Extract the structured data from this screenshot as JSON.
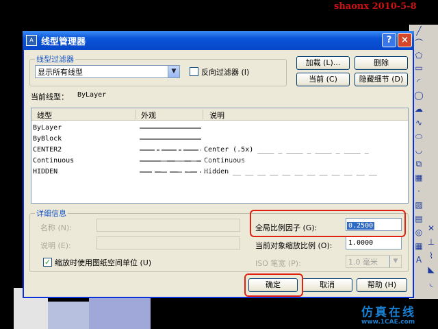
{
  "watermark": {
    "top_right": "shaonx 2010-5-8",
    "center": "1CAE.COM",
    "bottom_cn": "仿真在线",
    "bottom_url": "www.1CAE.com"
  },
  "dialog": {
    "title": "线型管理器",
    "help_label": "?",
    "close_label": "×",
    "filter_group": "线型过滤器",
    "filter_value": "显示所有线型",
    "invert_label": "反向过滤器 (I)",
    "load_button": "加载 (L)...",
    "delete_button": "删除",
    "current_button": "当前 (C)",
    "hide_details_button": "隐藏细节 (D)",
    "current_linetype_label": "当前线型：",
    "current_linetype_value": "ByLayer",
    "columns": [
      "线型",
      "外观",
      "说明"
    ],
    "rows": [
      {
        "name": "ByLayer",
        "description": ""
      },
      {
        "name": "ByBlock",
        "description": ""
      },
      {
        "name": "CENTER2",
        "description": "Center (.5x) ____ _ ____ _ ____ _ ____ _"
      },
      {
        "name": "Continuous",
        "description": "Continuous"
      },
      {
        "name": "HIDDEN",
        "description": "Hidden __ __ __ __ __ __ __ __ __ __ __ __"
      }
    ],
    "details_group": "详细信息",
    "name_label": "名称 (N):",
    "desc_label": "说明 (E):",
    "paper_units_label": "缩放时使用图纸空间单位 (U)",
    "global_scale_label": "全局比例因子 (G):",
    "global_scale_value": "0.2500",
    "object_scale_label": "当前对象缩放比例 (O):",
    "object_scale_value": "1.0000",
    "iso_pen_label": "ISO 笔宽 (P):",
    "iso_pen_value": "1.0 毫米",
    "ok_button": "确定",
    "cancel_button": "取消",
    "help_button": "帮助 (H)"
  },
  "colors": {
    "title_bar": "#0a55d8",
    "highlight_box": "#e02010",
    "dialog_bg": "#ece9d8"
  }
}
